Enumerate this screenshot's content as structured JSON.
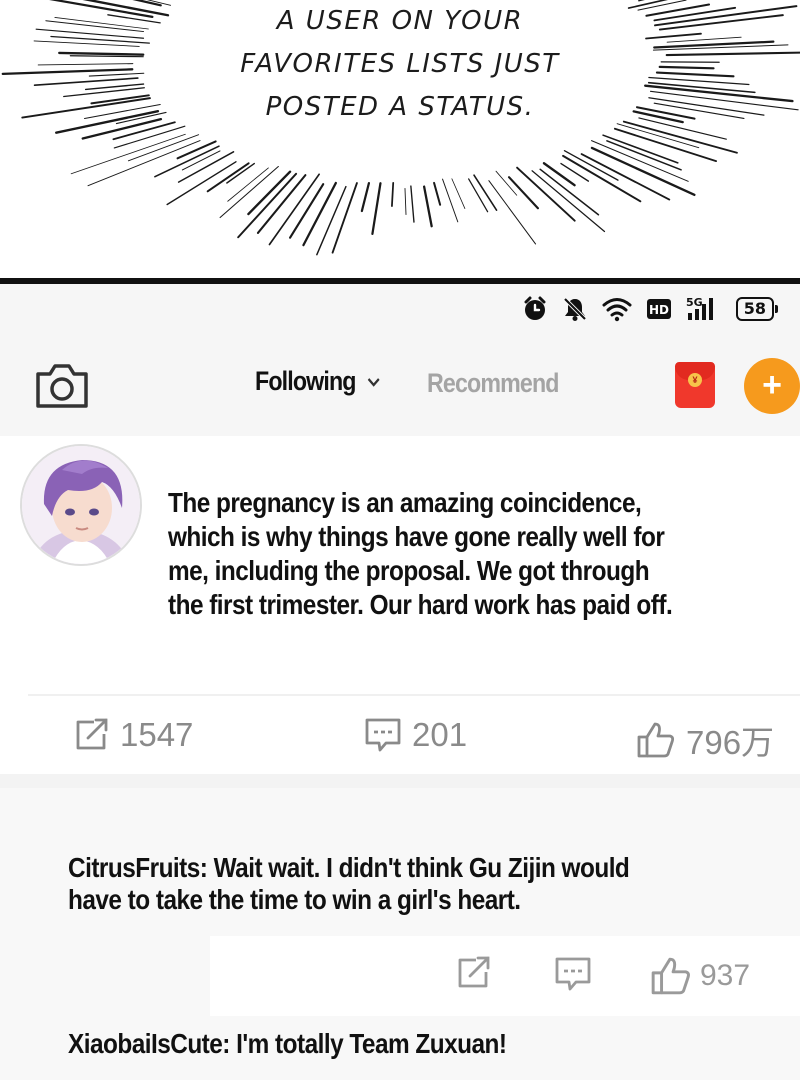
{
  "caption": {
    "lines": [
      "A USER ON YOUR",
      "FAVORITES LISTS JUST",
      "POSTED A STATUS."
    ]
  },
  "status_bar": {
    "icons": [
      "alarm-icon",
      "mute-icon",
      "wifi-icon",
      "hd-icon",
      "signal-5g-icon"
    ],
    "hd_label": "HD",
    "network_label": "5G",
    "battery": "58"
  },
  "nav": {
    "tabs": [
      {
        "label": "Following",
        "active": true
      },
      {
        "label": "Recommend",
        "active": false
      }
    ],
    "compose_label": "+",
    "redpacket_label": "¥"
  },
  "post": {
    "lines": [
      "The pregnancy is an amazing coincidence,",
      "which is why things have gone really well for",
      "me, including the proposal. We got through",
      "the first trimester. Our hard work has paid off."
    ],
    "shares": "1547",
    "comments": "201",
    "likes": "796万"
  },
  "comments": [
    {
      "lines": [
        "CitrusFruits: Wait wait. I didn't think Gu Zijin would",
        "have to take the time to win a girl's heart."
      ],
      "likes": "937"
    },
    {
      "lines": [
        "XiaobaiIsCute: I'm totally Team Zuxuan!"
      ]
    }
  ],
  "colors": {
    "accent_orange": "#f69a1d",
    "redpacket": "#f0382c",
    "muted_gray": "#8a8a8a"
  }
}
